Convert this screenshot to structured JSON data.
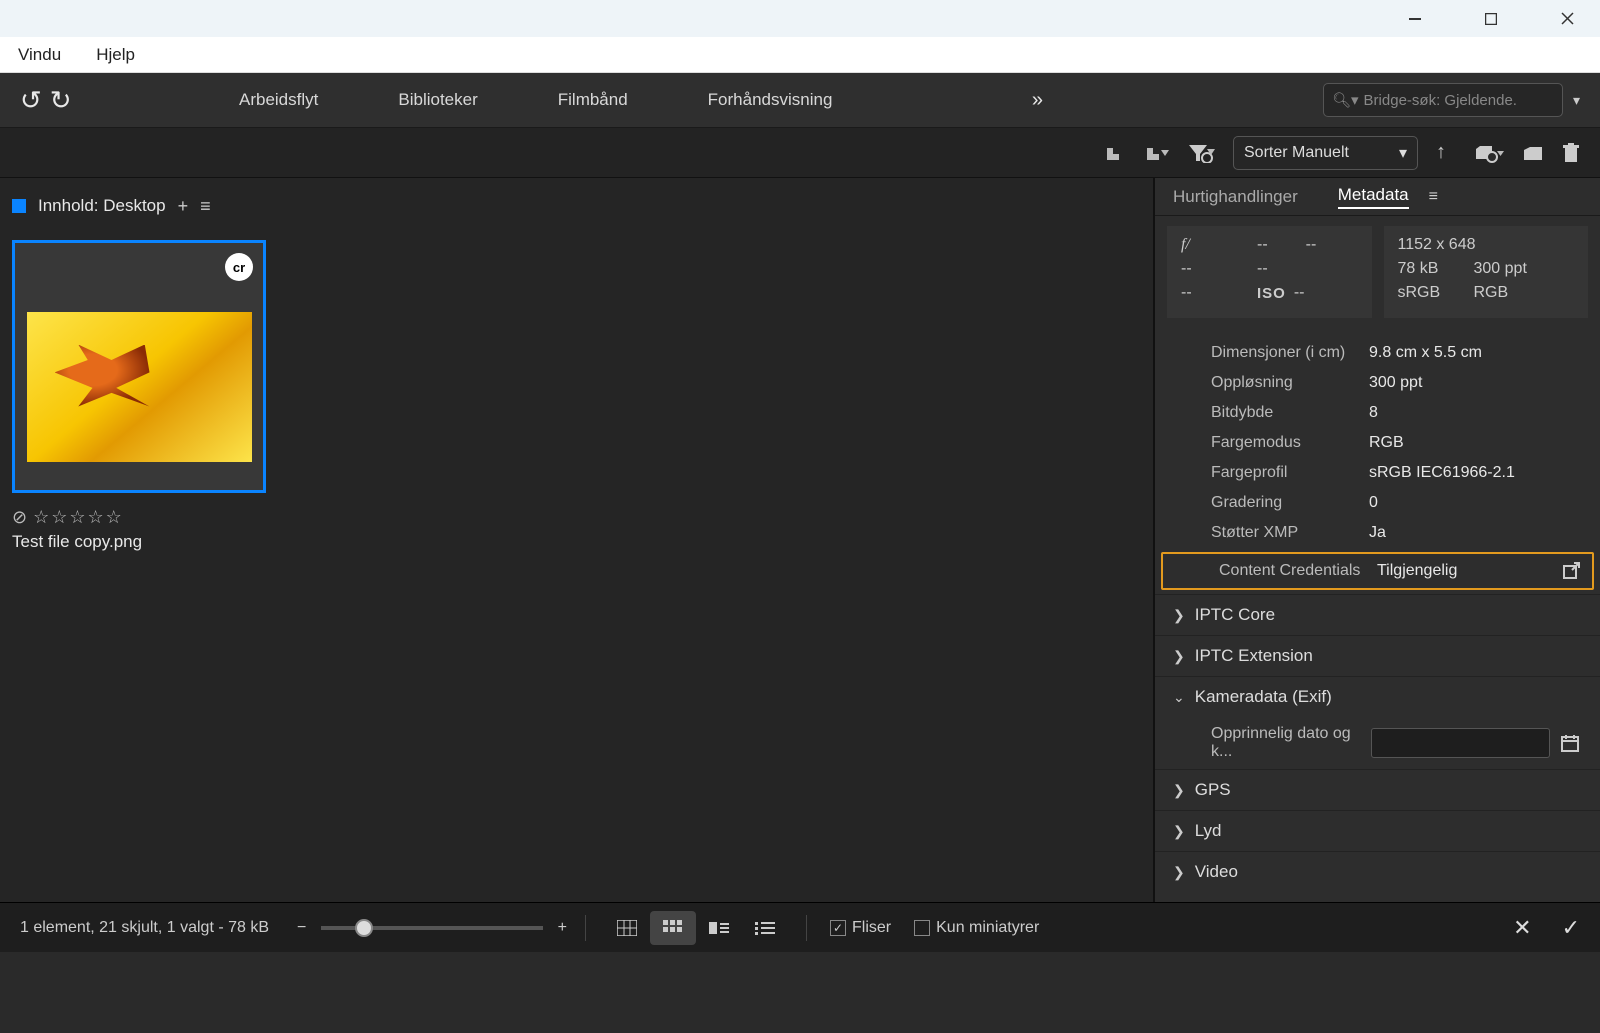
{
  "menubar": {
    "items": [
      "Vindu",
      "Hjelp"
    ]
  },
  "toolbar1": {
    "workspaces": [
      "Arbeidsflyt",
      "Biblioteker",
      "Filmbånd",
      "Forhåndsvisning"
    ],
    "search_placeholder": "Bridge-søk: Gjeldende."
  },
  "toolbar2": {
    "sort_label": "Sorter Manuelt"
  },
  "content": {
    "title": "Innhold: Desktop",
    "thumbnail": {
      "filename": "Test file copy.png",
      "badge": "cr"
    }
  },
  "side_panel": {
    "tabs": {
      "quick": "Hurtighandlinger",
      "meta": "Metadata"
    },
    "summary_left": {
      "aperture_label": "f/",
      "aperture_val": "--",
      "shutter_label": "--",
      "shutter_val": "--",
      "comp_label": "--",
      "iso_label": "ISO",
      "iso_val": "--"
    },
    "summary_right": {
      "dim": "1152 x 648",
      "size": "78 kB",
      "res": "300 ppt",
      "cs": "sRGB",
      "mode": "RGB"
    },
    "props": [
      {
        "k": "Dimensjoner (i cm)",
        "v": "9.8 cm x 5.5 cm"
      },
      {
        "k": "Oppløsning",
        "v": "300 ppt"
      },
      {
        "k": "Bitdybde",
        "v": "8"
      },
      {
        "k": "Fargemodus",
        "v": "RGB"
      },
      {
        "k": "Fargeprofil",
        "v": "sRGB IEC61966-2.1"
      },
      {
        "k": "Gradering",
        "v": "0"
      },
      {
        "k": "Støtter XMP",
        "v": "Ja"
      }
    ],
    "content_cred": {
      "k": "Content Credentials",
      "v": "Tilgjengelig"
    },
    "sections": {
      "iptc_core": "IPTC Core",
      "iptc_ext": "IPTC Extension",
      "camera": "Kameradata (Exif)",
      "camera_field": "Opprinnelig dato og k...",
      "gps": "GPS",
      "lyd": "Lyd",
      "video": "Video"
    }
  },
  "statusbar": {
    "text": "1 element, 21 skjult, 1 valgt - 78 kB",
    "tiles_label": "Fliser",
    "thumbs_label": "Kun miniatyrer"
  }
}
